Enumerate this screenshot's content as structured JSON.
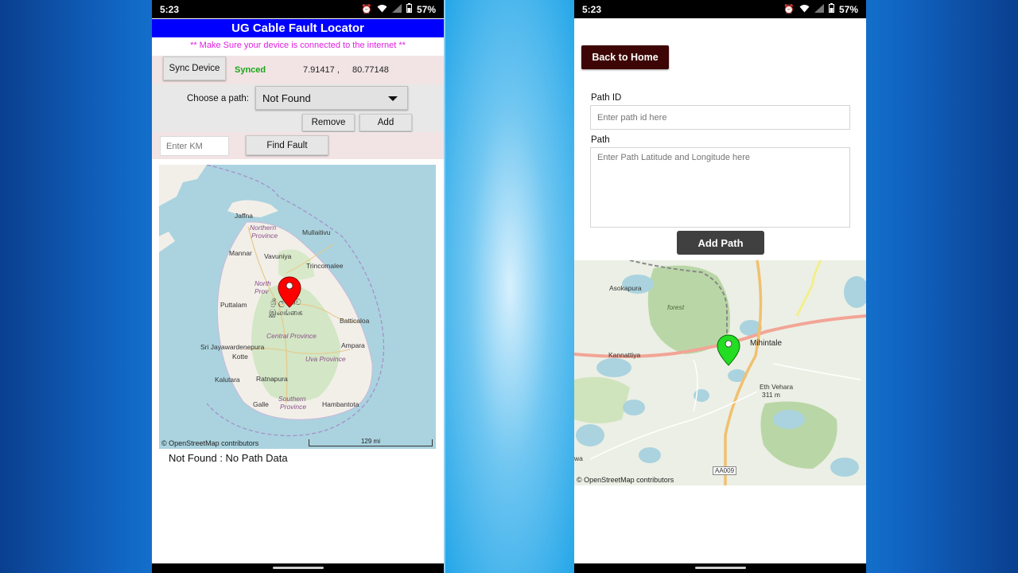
{
  "colors": {
    "title_bar": "#0000ff",
    "warning_text": "#e020e0",
    "synced_text": "#1aa51a",
    "back_button": "#3d0505",
    "add_path_button": "#404040",
    "marker_left": "#ff0000",
    "marker_right": "#22dd22"
  },
  "left_phone": {
    "status": {
      "time": "5:23",
      "battery": "57%"
    },
    "title": "UG Cable Fault Locator",
    "warning": "** Make Sure your device is connected to the internet **",
    "sync_button": "Sync Device",
    "sync_status": "Synced",
    "lat": "7.91417 ,",
    "lng": "80.77148",
    "choose_label": "Choose a path:",
    "path_select": {
      "selected": "Not Found"
    },
    "remove_button": "Remove",
    "add_button": "Add",
    "km_placeholder": "Enter KM",
    "find_fault_button": "Find Fault",
    "map": {
      "labels": {
        "jaffna": "Jaffna",
        "northern1": "Northern",
        "northern2": "Province",
        "mullaitivu": "Mullaitivu",
        "mannar": "Mannar",
        "vavuniya": "Vavuniya",
        "trincomalee": "Trincomalee",
        "north": "North",
        "prov": "Prov",
        "sinhala": "ශ්‍රී ලංකාව",
        "tamil": "இலங்கை",
        "puttalam": "Puttalam",
        "batticaloa": "Batticaloa",
        "central": "Central Province",
        "ampara": "Ampara",
        "srijaya": "Sri Jayawardenepura",
        "kotte": "Kotte",
        "uva": "Uva Province",
        "kalutara": "Kalutara",
        "ratnapura": "Ratnapura",
        "southern1": "Southern",
        "southern2": "Province",
        "galle": "Galle",
        "hambantota": "Hambantota"
      },
      "attribution": "© OpenStreetMap contributors",
      "scale": "129 mi"
    },
    "status_message": "Not Found : No Path Data"
  },
  "right_phone": {
    "status": {
      "time": "5:23",
      "battery": "57%"
    },
    "back_button": "Back to Home",
    "path_id_label": "Path ID",
    "path_id_placeholder": "Enter path id here",
    "path_label": "Path",
    "path_placeholder": "Enter Path Latitude and Longitude here",
    "add_path_button": "Add Path",
    "map": {
      "labels": {
        "asokapura": "Asokapura",
        "forest": "forest",
        "kannattiya": "Kannattiya",
        "mihintale": "Mihintale",
        "eth_vehara": "Eth Vehara",
        "elevation": "311 m",
        "road": "AA009",
        "wa": "wa"
      },
      "attribution": "© OpenStreetMap contributors"
    }
  }
}
